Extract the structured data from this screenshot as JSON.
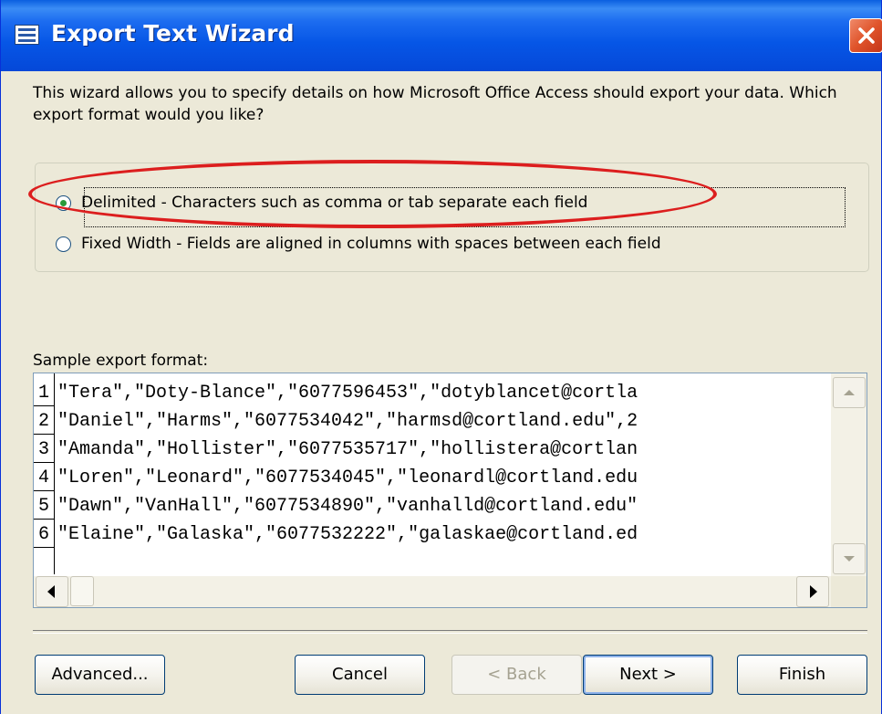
{
  "window": {
    "title": "Export Text Wizard"
  },
  "intro": {
    "text": "This wizard allows you to specify details on how Microsoft Office Access should export your data. Which export format would you like?"
  },
  "format": {
    "options": [
      {
        "label": "Delimited - Characters such as comma or tab separate each field",
        "checked": true
      },
      {
        "label": "Fixed Width - Fields are aligned in columns with spaces between each field",
        "checked": false
      }
    ],
    "highlight_color": "#dc1e1e"
  },
  "sample": {
    "label": "Sample export format:",
    "rows": [
      {
        "num": "1",
        "text": "\"Tera\",\"Doty-Blance\",\"6077596453\",\"dotyblancet@cortla"
      },
      {
        "num": "2",
        "text": "\"Daniel\",\"Harms\",\"6077534042\",\"harmsd@cortland.edu\",2"
      },
      {
        "num": "3",
        "text": "\"Amanda\",\"Hollister\",\"6077535717\",\"hollistera@cortlan"
      },
      {
        "num": "4",
        "text": "\"Loren\",\"Leonard\",\"6077534045\",\"leonardl@cortland.edu"
      },
      {
        "num": "5",
        "text": "\"Dawn\",\"VanHall\",\"6077534890\",\"vanhalld@cortland.edu\""
      },
      {
        "num": "6",
        "text": "\"Elaine\",\"Galaska\",\"6077532222\",\"galaskae@cortland.ed"
      }
    ]
  },
  "buttons": {
    "advanced": "Advanced...",
    "cancel": "Cancel",
    "back": "< Back",
    "next": "Next >",
    "finish": "Finish"
  }
}
